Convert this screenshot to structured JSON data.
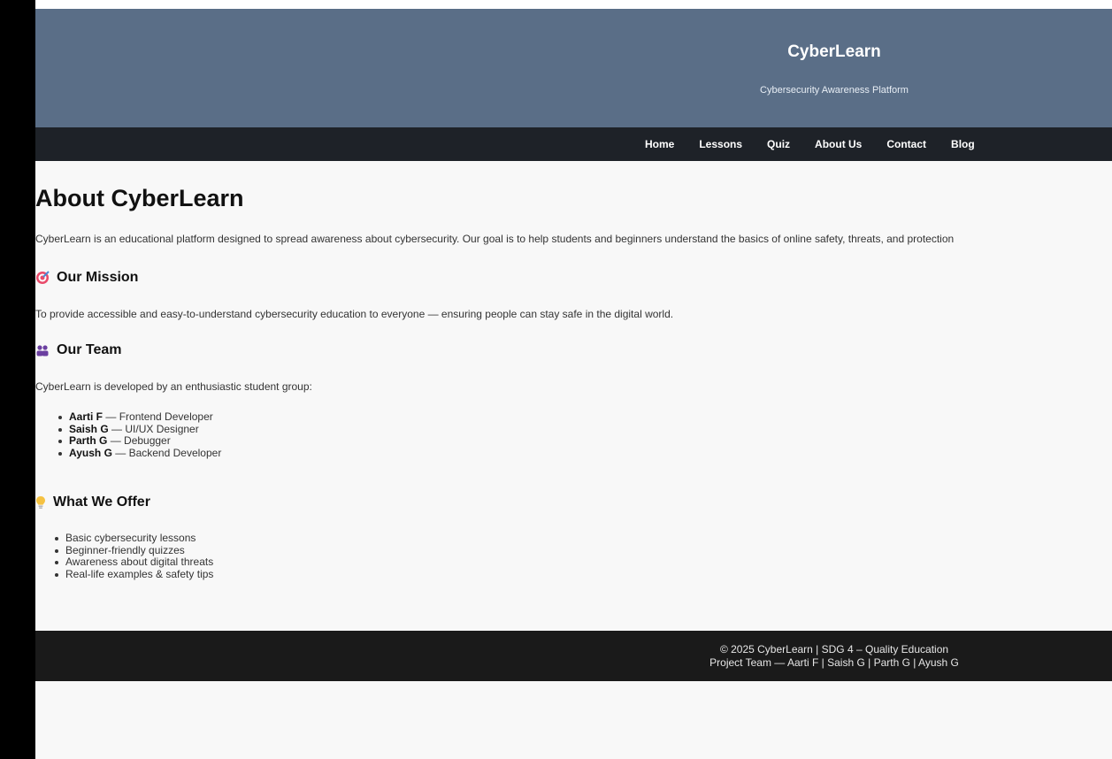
{
  "header": {
    "site_title": "CyberLearn",
    "site_subtitle": "Cybersecurity Awareness Platform"
  },
  "nav": {
    "items": [
      "Home",
      "Lessons",
      "Quiz",
      "About Us",
      "Contact",
      "Blog"
    ]
  },
  "main": {
    "title": "About CyberLearn",
    "intro": "CyberLearn is an educational platform designed to spread awareness about cybersecurity. Our goal is to help students and beginners understand the basics of online safety, threats, and protection",
    "mission": {
      "heading": "Our Mission",
      "icon": "target-icon",
      "text": "To provide accessible and easy-to-understand cybersecurity education to everyone — ensuring people can stay safe in the digital world."
    },
    "team": {
      "heading": "Our Team",
      "icon": "people-icon",
      "intro": "CyberLearn is developed by an enthusiastic student group:",
      "members": [
        {
          "name": "Aarti F",
          "role": "— Frontend Developer"
        },
        {
          "name": "Saish G",
          "role": "— UI/UX Designer"
        },
        {
          "name": "Parth G",
          "role": "— Debugger"
        },
        {
          "name": "Ayush G",
          "role": "— Backend Developer"
        }
      ]
    },
    "offer": {
      "heading": "What We Offer",
      "icon": "lightbulb-icon",
      "items": [
        "Basic cybersecurity lessons",
        "Beginner-friendly quizzes",
        "Awareness about digital threats",
        "Real-life examples & safety tips"
      ]
    }
  },
  "footer": {
    "line1": "© 2025 CyberLearn | SDG 4 – Quality Education",
    "line2": "Project Team — Aarti F | Saish G | Parth G | Ayush G"
  },
  "colors": {
    "header_bg": "#5a6e87",
    "nav_bg": "#1e2228",
    "footer_bg": "#1a1a1a",
    "page_bg": "#f8f8f8"
  }
}
